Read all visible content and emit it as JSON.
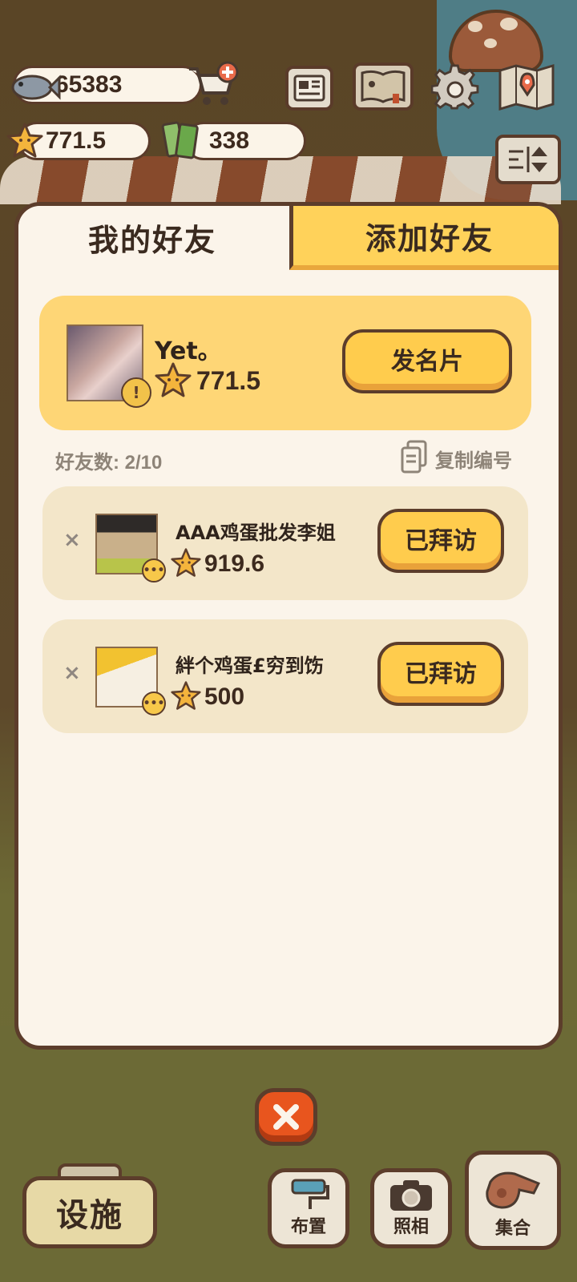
{
  "hud": {
    "fish_count": "65383",
    "star_score": "771.5",
    "ticket_count": "338"
  },
  "tabs": [
    {
      "label": "我的好友",
      "active": true
    },
    {
      "label": "添加好友",
      "active": false
    }
  ],
  "my_card": {
    "name": "Yet。",
    "score": "771.5",
    "button_label": "发名片"
  },
  "friend_meta": {
    "count_label": "好友数: 2/10",
    "copy_label": "复制编号"
  },
  "friends": [
    {
      "name": "AAA鸡蛋批发李姐",
      "score": "919.6",
      "button_label": "已拜访",
      "remove_symbol": "×"
    },
    {
      "name": "絆个鸡蛋£穷到饬",
      "score": "500",
      "button_label": "已拜访",
      "remove_symbol": "×"
    }
  ],
  "bottom": {
    "facility_label": "设施",
    "tools": [
      {
        "label": "布置",
        "icon": "paint-roller-icon"
      },
      {
        "label": "照相",
        "icon": "camera-icon"
      },
      {
        "label": "集合",
        "icon": "whistle-icon"
      }
    ]
  },
  "colors": {
    "panel": "#fbf4ea",
    "border": "#5c3d2b",
    "accent_yellow": "#ffcc4d",
    "close_orange": "#e8551e"
  }
}
